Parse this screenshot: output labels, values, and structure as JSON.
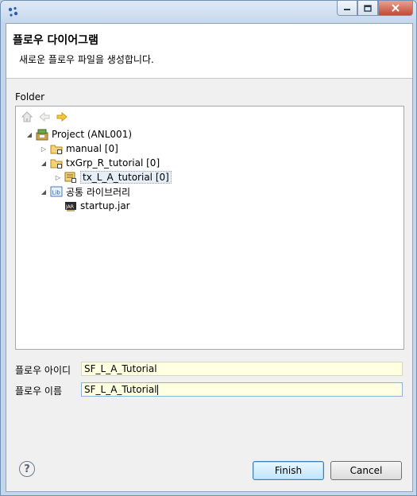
{
  "window": {
    "app_icon": "eclipse-dots-icon"
  },
  "header": {
    "title": "플로우 다이어그램",
    "message": "새로운 플로우 파일을 생성합니다."
  },
  "folder": {
    "label": "Folder",
    "toolbar": [
      "home-icon",
      "back-arrow-icon",
      "forward-arrow-icon"
    ],
    "tree": [
      {
        "label": "Project  (ANL001)",
        "expanded": true,
        "icon": "project-icon"
      },
      {
        "label": "manual [0]",
        "expanded": false,
        "icon": "package-folder-icon"
      },
      {
        "label": "txGrp_R_tutorial [0]",
        "expanded": true,
        "icon": "package-folder-icon"
      },
      {
        "label": "tx_L_A_tutorial [0]",
        "expanded": false,
        "icon": "transaction-icon",
        "selected": true
      },
      {
        "label": "공통 라이브러리",
        "expanded": true,
        "icon": "library-icon"
      },
      {
        "label": "startup.jar",
        "icon": "jar-icon"
      }
    ]
  },
  "form": {
    "flow_id_label": "플로우 아이디",
    "flow_id_value": "SF_L_A_Tutorial",
    "flow_name_label": "플로우 이름",
    "flow_name_value": "SF_L_A_Tutorial"
  },
  "footer": {
    "help_symbol": "?",
    "finish_label": "Finish",
    "cancel_label": "Cancel"
  }
}
